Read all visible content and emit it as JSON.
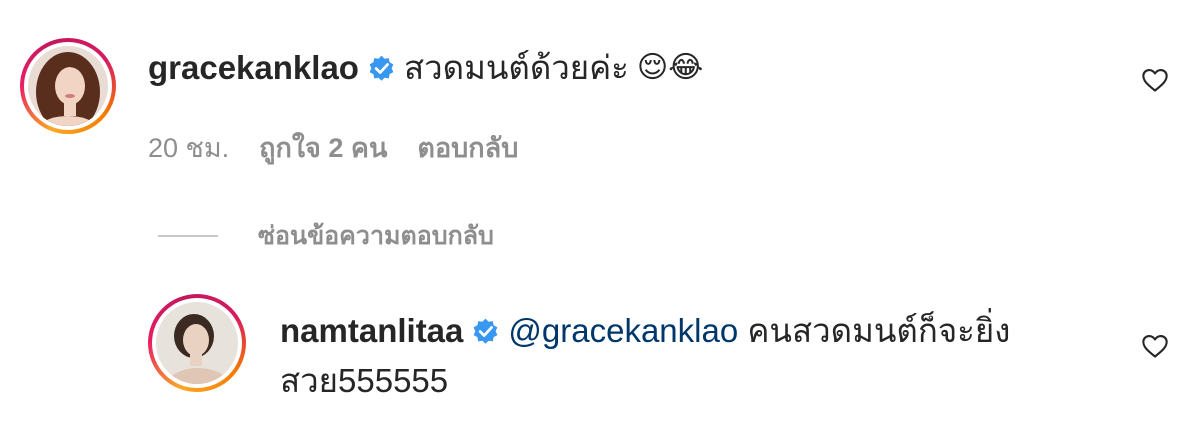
{
  "comment": {
    "username": "gracekanklao",
    "text": "สวดมนต์ด้วยค่ะ",
    "emojis": "😌😂",
    "time": "20 ชม.",
    "likes": "ถูกใจ 2 คน",
    "reply_label": "ตอบกลับ"
  },
  "hide_replies": {
    "label": "ซ่อนข้อความตอบกลับ"
  },
  "reply": {
    "username": "namtanlitaa",
    "mention": "@gracekanklao",
    "text_line1": "คนสวดมนต์ก็จะยิ่ง",
    "text_line2": "สวย555555"
  },
  "icons": {
    "verified": "verified-badge-icon",
    "heart": "heart-outline-icon"
  },
  "colors": {
    "verified_blue": "#3897f0",
    "mention_blue": "#00376b",
    "muted_text": "#8e8e8e"
  }
}
